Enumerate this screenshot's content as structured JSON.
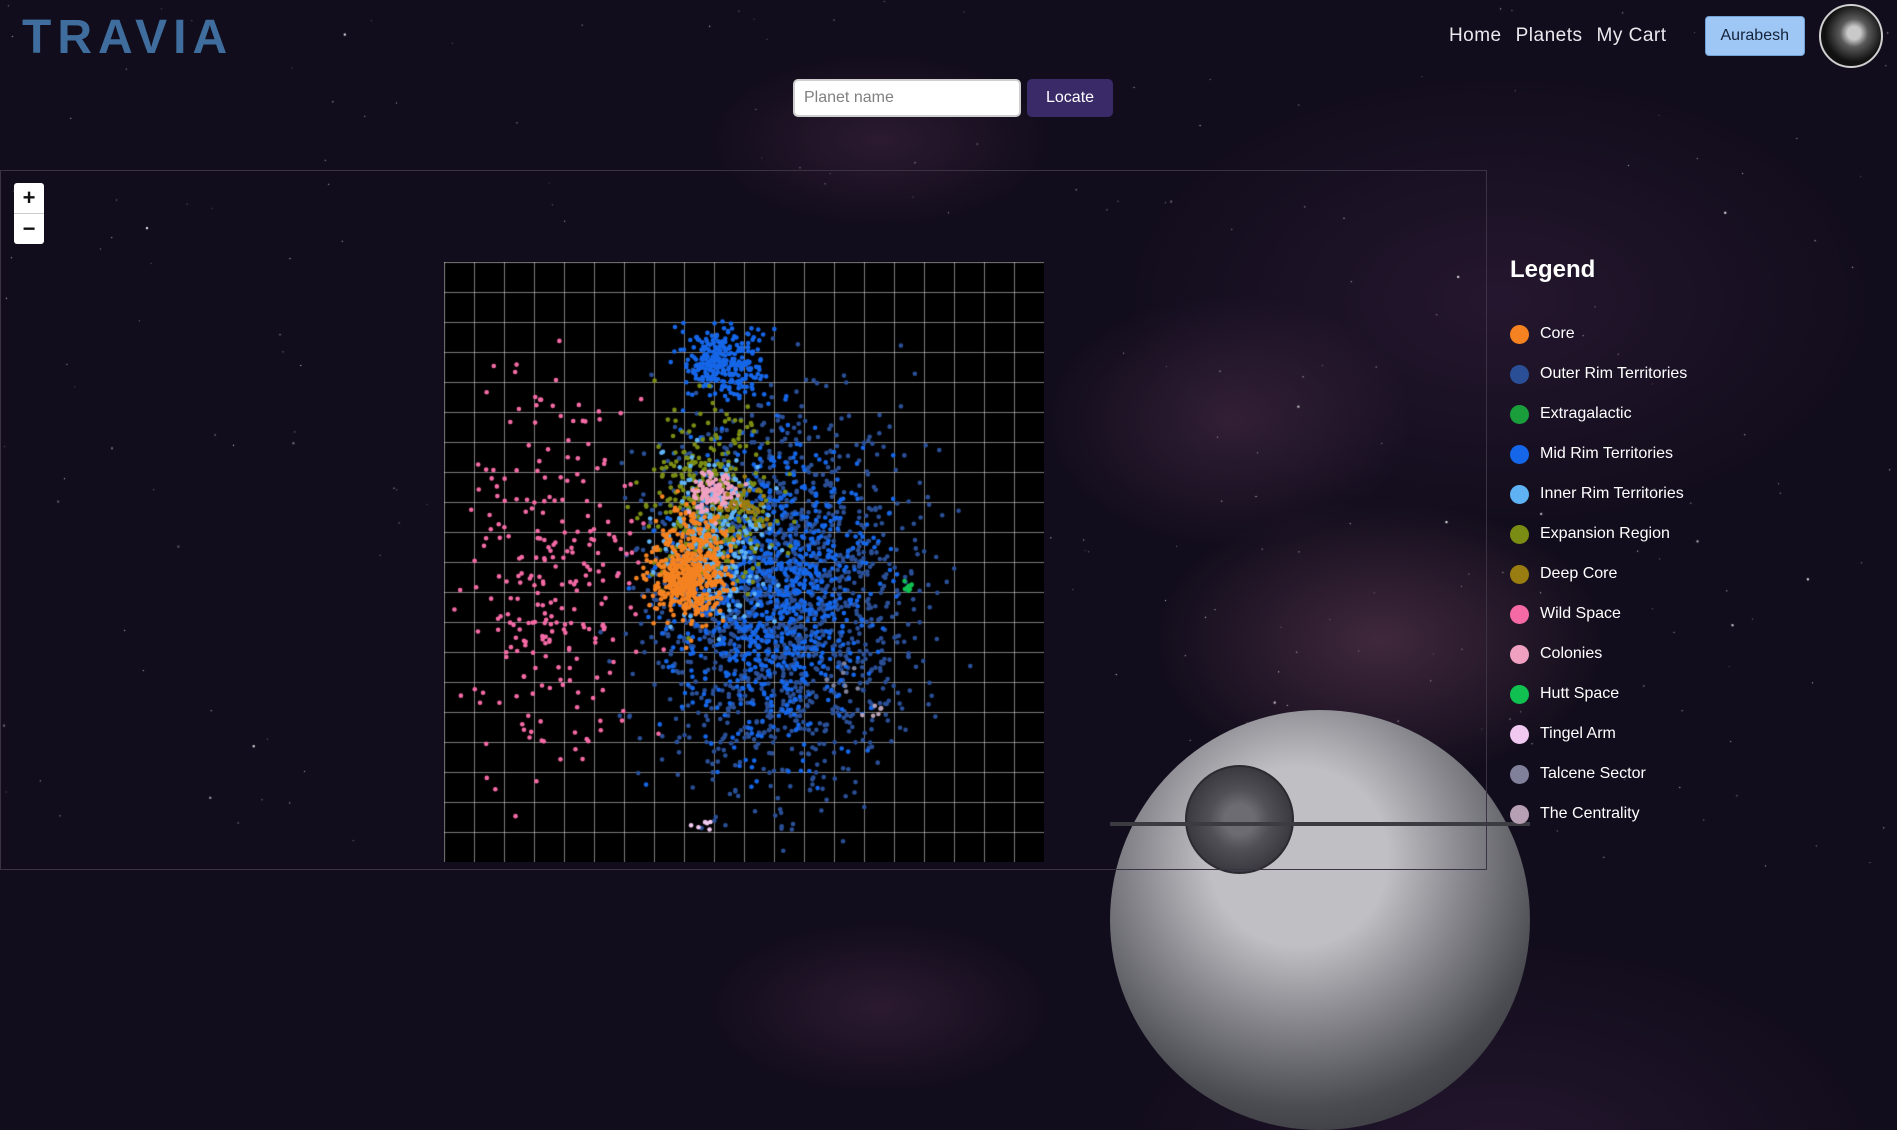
{
  "brand": {
    "logo": "TRAVIA"
  },
  "nav": {
    "links": [
      "Home",
      "Planets",
      "My Cart"
    ],
    "aurabesh_label": "Aurabesh"
  },
  "search": {
    "placeholder": "Planet name",
    "value": "",
    "button_label": "Locate"
  },
  "map": {
    "zoom_in_label": "+",
    "zoom_out_label": "−"
  },
  "legend": {
    "title": "Legend",
    "items": [
      {
        "label": "Core",
        "color": "#f58220"
      },
      {
        "label": "Outer Rim Territories",
        "color": "#2a4f96"
      },
      {
        "label": "Extragalactic",
        "color": "#1a9e3c"
      },
      {
        "label": "Mid Rim Territories",
        "color": "#1566e8"
      },
      {
        "label": "Inner Rim Territories",
        "color": "#5fb3f5"
      },
      {
        "label": "Expansion Region",
        "color": "#7a8c14"
      },
      {
        "label": "Deep Core",
        "color": "#9a7d10"
      },
      {
        "label": "Wild Space",
        "color": "#f56aa5"
      },
      {
        "label": "Colonies",
        "color": "#f0a0c0"
      },
      {
        "label": "Hutt Space",
        "color": "#10c050"
      },
      {
        "label": "Tingel Arm",
        "color": "#f0c8f0"
      },
      {
        "label": "Talcene Sector",
        "color": "#80809a"
      },
      {
        "label": "The Centrality",
        "color": "#b8a0b4"
      }
    ]
  }
}
